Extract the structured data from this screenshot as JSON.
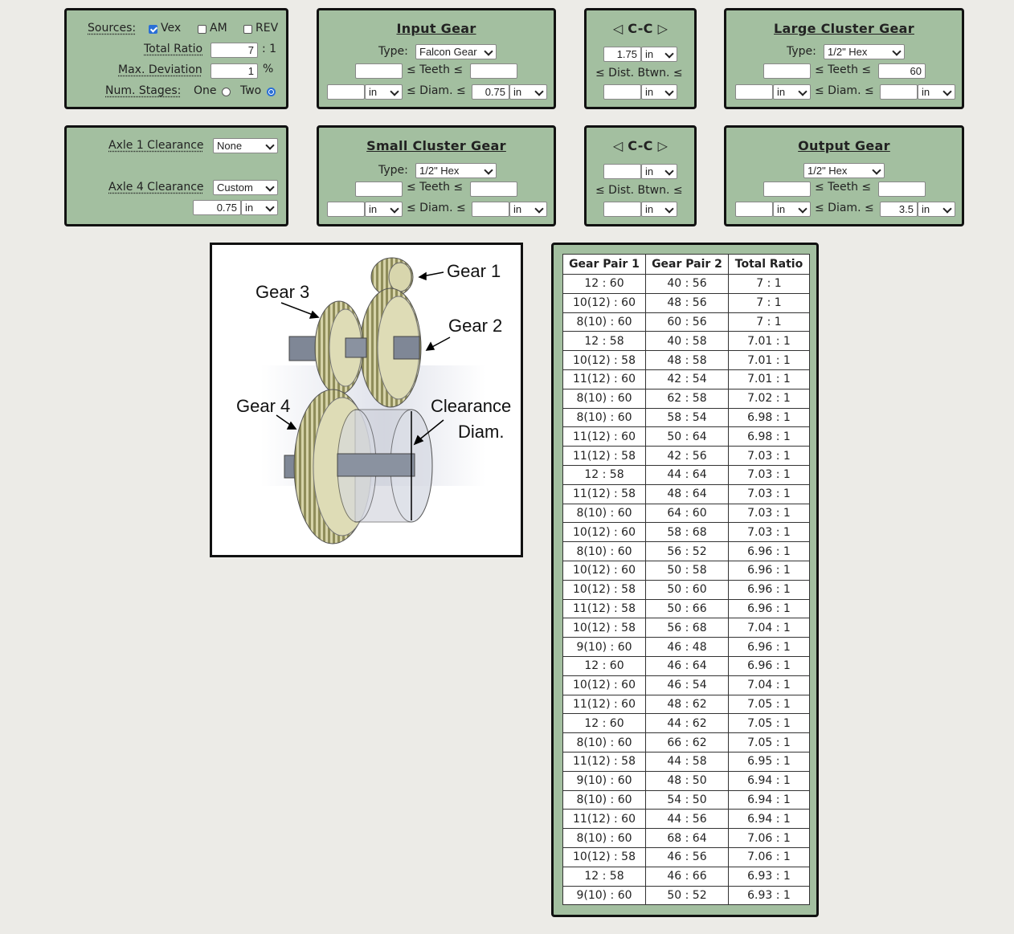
{
  "sources": {
    "label": "Sources:",
    "vex": {
      "label": "Vex",
      "checked": true
    },
    "am": {
      "label": "AM",
      "checked": false
    },
    "rev": {
      "label": "REV",
      "checked": false
    },
    "total_ratio_label": "Total Ratio",
    "total_ratio_value": "7",
    "ratio_suffix": ": 1",
    "max_dev_label": "Max. Deviation",
    "max_dev_value": "1",
    "percent": "%",
    "num_stages_label": "Num. Stages:",
    "one_label": "One",
    "two_label": "Two",
    "selected_stages": "Two"
  },
  "common": {
    "type_label": "Type:",
    "teeth_label": "≤ Teeth ≤",
    "diam_label": "≤ Diam. ≤",
    "dist_label": "≤ Dist. Btwn. ≤",
    "unit_in": "in",
    "cc_title": "◁ C-C ▷"
  },
  "input_gear": {
    "title": "Input Gear",
    "type": "Falcon Gear",
    "teeth_min": "",
    "teeth_max": "",
    "diam_min": "",
    "diam_min_unit": "in",
    "diam_max": "0.75",
    "diam_max_unit": "in"
  },
  "cc1": {
    "value": "1.75",
    "value_unit": "in",
    "dist_value": "",
    "dist_unit": "in"
  },
  "large_cluster_gear": {
    "title": "Large Cluster Gear",
    "type": "1/2\" Hex",
    "teeth_min": "",
    "teeth_max": "60",
    "diam_min": "",
    "diam_min_unit": "in",
    "diam_max": "",
    "diam_max_unit": "in"
  },
  "axles": {
    "axle1_label": "Axle 1 Clearance",
    "axle1_value": "None",
    "axle4_label": "Axle 4 Clearance",
    "axle4_value": "Custom",
    "axle4_diam": "0.75",
    "axle4_unit": "in"
  },
  "small_cluster_gear": {
    "title": "Small Cluster Gear",
    "type": "1/2\" Hex",
    "teeth_min": "",
    "teeth_max": "",
    "diam_min": "",
    "diam_min_unit": "in",
    "diam_max": "",
    "diam_max_unit": "in"
  },
  "cc2": {
    "value": "",
    "value_unit": "in",
    "dist_value": "",
    "dist_unit": "in"
  },
  "output_gear": {
    "title": "Output Gear",
    "type": "1/2\" Hex",
    "teeth_min": "",
    "teeth_max": "",
    "diam_min": "",
    "diam_min_unit": "in",
    "diam_max": "3.5",
    "diam_max_unit": "in"
  },
  "diagram": {
    "gear1": "Gear 1",
    "gear2": "Gear 2",
    "gear3": "Gear 3",
    "gear4": "Gear 4",
    "clearance1": "Clearance",
    "clearance2": "Diam."
  },
  "results": {
    "headers": [
      "Gear Pair 1",
      "Gear Pair 2",
      "Total Ratio"
    ],
    "rows": [
      [
        "12 : 60",
        "40 : 56",
        "7 : 1"
      ],
      [
        "10(12) : 60",
        "48 : 56",
        "7 : 1"
      ],
      [
        "8(10) : 60",
        "60 : 56",
        "7 : 1"
      ],
      [
        "12 : 58",
        "40 : 58",
        "7.01 : 1"
      ],
      [
        "10(12) : 58",
        "48 : 58",
        "7.01 : 1"
      ],
      [
        "11(12) : 60",
        "42 : 54",
        "7.01 : 1"
      ],
      [
        "8(10) : 60",
        "62 : 58",
        "7.02 : 1"
      ],
      [
        "8(10) : 60",
        "58 : 54",
        "6.98 : 1"
      ],
      [
        "11(12) : 60",
        "50 : 64",
        "6.98 : 1"
      ],
      [
        "11(12) : 58",
        "42 : 56",
        "7.03 : 1"
      ],
      [
        "12 : 58",
        "44 : 64",
        "7.03 : 1"
      ],
      [
        "11(12) : 58",
        "48 : 64",
        "7.03 : 1"
      ],
      [
        "8(10) : 60",
        "64 : 60",
        "7.03 : 1"
      ],
      [
        "10(12) : 60",
        "58 : 68",
        "7.03 : 1"
      ],
      [
        "8(10) : 60",
        "56 : 52",
        "6.96 : 1"
      ],
      [
        "10(12) : 60",
        "50 : 58",
        "6.96 : 1"
      ],
      [
        "10(12) : 58",
        "50 : 60",
        "6.96 : 1"
      ],
      [
        "11(12) : 58",
        "50 : 66",
        "6.96 : 1"
      ],
      [
        "10(12) : 58",
        "56 : 68",
        "7.04 : 1"
      ],
      [
        "9(10) : 60",
        "46 : 48",
        "6.96 : 1"
      ],
      [
        "12 : 60",
        "46 : 64",
        "6.96 : 1"
      ],
      [
        "10(12) : 60",
        "46 : 54",
        "7.04 : 1"
      ],
      [
        "11(12) : 60",
        "48 : 62",
        "7.05 : 1"
      ],
      [
        "12 : 60",
        "44 : 62",
        "7.05 : 1"
      ],
      [
        "8(10) : 60",
        "66 : 62",
        "7.05 : 1"
      ],
      [
        "11(12) : 58",
        "44 : 58",
        "6.95 : 1"
      ],
      [
        "9(10) : 60",
        "48 : 50",
        "6.94 : 1"
      ],
      [
        "8(10) : 60",
        "54 : 50",
        "6.94 : 1"
      ],
      [
        "11(12) : 60",
        "44 : 56",
        "6.94 : 1"
      ],
      [
        "8(10) : 60",
        "68 : 64",
        "7.06 : 1"
      ],
      [
        "10(12) : 58",
        "46 : 56",
        "7.06 : 1"
      ],
      [
        "12 : 58",
        "46 : 66",
        "6.93 : 1"
      ],
      [
        "9(10) : 60",
        "50 : 52",
        "6.93 : 1"
      ]
    ]
  }
}
